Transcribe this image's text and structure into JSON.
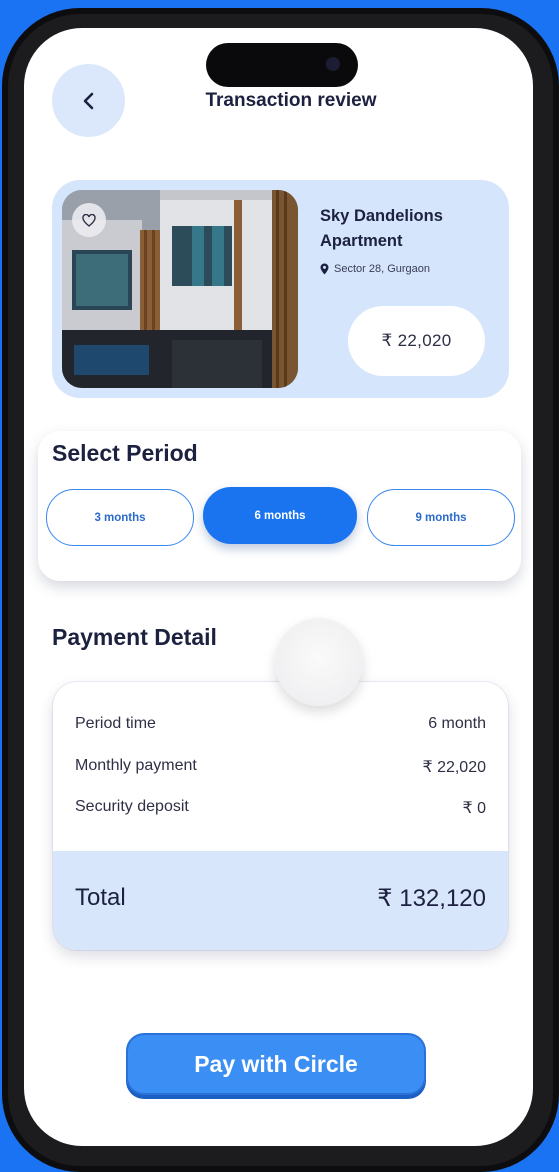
{
  "header": {
    "title": "Transaction review",
    "back_icon": "chevron-left-icon"
  },
  "property": {
    "name": "Sky Dandelions Apartment",
    "location": "Sector 28, Gurgaon",
    "price": "₹ 22,020",
    "favorite_icon": "heart-icon",
    "location_icon": "map-pin-icon"
  },
  "period": {
    "title": "Select Period",
    "options": [
      {
        "label": "3 months",
        "selected": false
      },
      {
        "label": "6 months",
        "selected": true
      },
      {
        "label": "9 months",
        "selected": false
      }
    ]
  },
  "payment": {
    "title": "Payment Detail",
    "rows": [
      {
        "label": "Period time",
        "value": "6 month"
      },
      {
        "label": "Monthly payment",
        "value": "₹ 22,020"
      },
      {
        "label": "Security deposit",
        "value": "₹ 0"
      }
    ],
    "total_label": "Total",
    "total_value": "₹ 132,120"
  },
  "cta": {
    "label": "Pay with Circle"
  },
  "colors": {
    "accent": "#1a74f0",
    "card_bg": "#d5e5fb",
    "text_dark": "#1d2140"
  }
}
